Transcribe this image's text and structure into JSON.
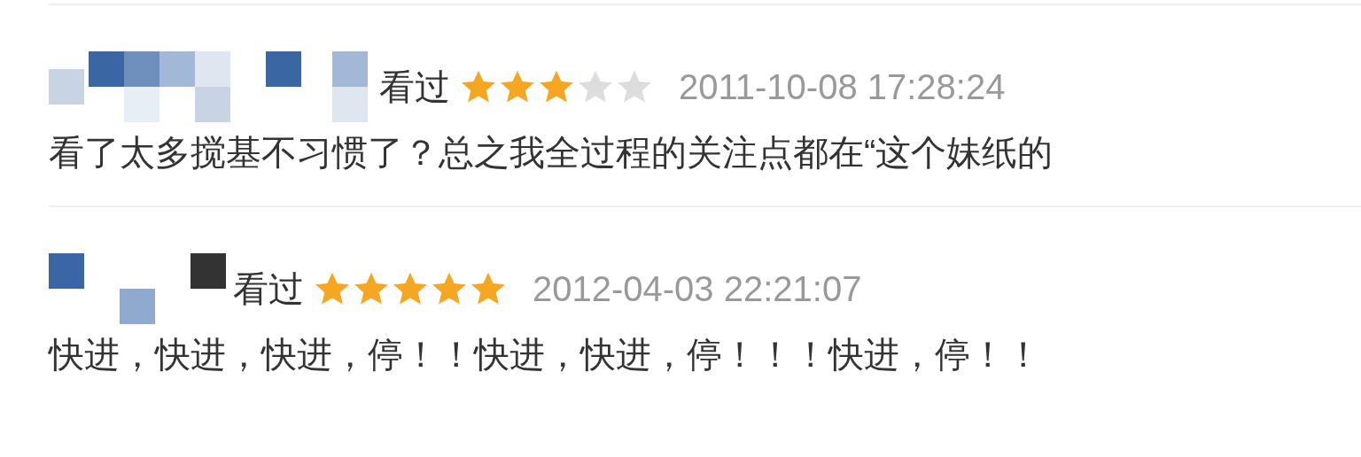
{
  "comments": [
    {
      "status": "看过",
      "stars": 3,
      "time": "2011-10-08 17:28:24",
      "text": "看了太多搅基不习惯了？总之我全过程的关注点都在“这个妹纸的"
    },
    {
      "status": "看过",
      "stars": 5,
      "time": "2012-04-03 22:21:07",
      "text": "快进，快进，快进，停！！快进，快进，停！！！快进，停！！"
    }
  ]
}
